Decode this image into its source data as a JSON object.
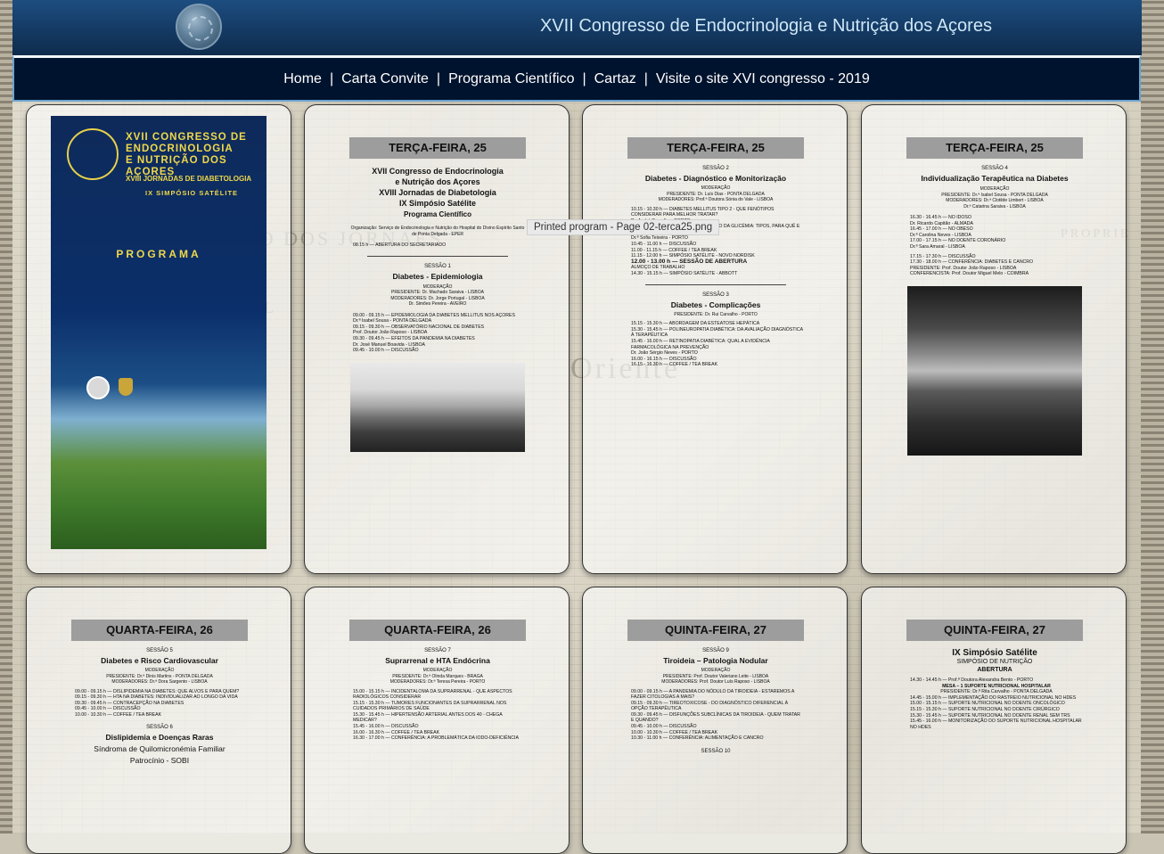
{
  "header": {
    "title": "XVII Congresso de Endocrinologia e Nutrição dos Açores"
  },
  "nav": {
    "items": [
      "Home",
      "Carta Convite",
      "Programa Científico",
      "Cartaz",
      "Visite o site XVI congresso - 2019"
    ],
    "separator": "|"
  },
  "tooltip": "Printed program - Page 02-terca25.png",
  "cover": {
    "title_lines": [
      "XVII CONGRESSO DE",
      "ENDOCRINOLOGIA",
      "E NUTRIÇÃO DOS AÇORES"
    ],
    "subtitle": "XVIII JORNADAS DE DIABETOLOGIA",
    "subtitle2": "IX SIMPÓSIO SATÉLITE",
    "program": "PROGRAMA"
  },
  "pages": {
    "p2": {
      "day": "TERÇA-FEIRA, 25",
      "intro": [
        "XVII Congresso de Endocrinologia",
        "e Nutrição dos Açores",
        "XVIII Jornadas de Diabetologia",
        "IX Simpósio Satélite"
      ],
      "intro_sub": "Programa Científico",
      "org": "Organização: Serviço de Endocrinologia e Nutrição do Hospital do Divino Espírito Santo de Ponta Delgada - EPER",
      "opening": "08.15 h — ABERTURA DO SECRETARIADO",
      "session": "SESSÃO 1",
      "session_title": "Diabetes - Epidemiologia",
      "moderation": "MODERAÇÃO",
      "president": "PRESIDENTE: Dr. Machado Saraiva - LISBOA",
      "moderators": "MODERADORES: Dr. Jorge Portugal - LISBOA",
      "moderators2": "Dr. Simões Pereira - AVEIRO",
      "lines": [
        "09.00 - 09.15 h — EPIDEMIOLOGIA DA DIABETES MELLITUS NOS AÇORES",
        "Dr.ª Isabel Sousa - PONTA DELGADA",
        "09.15 - 09.30 h — OBSERVATÓRIO NACIONAL DE DIABETES",
        "Prof. Doutor João Raposo - LISBOA",
        "09.30 - 09.45 h — EFEITOS DA PANDEMIA NA DIABETES",
        "Dr. José Manuel Boavida - LISBOA",
        "09.45 - 10.00 h — DISCUSSÃO"
      ]
    },
    "p3": {
      "day": "TERÇA-FEIRA, 25",
      "session": "SESSÃO 2",
      "session_title": "Diabetes - Diagnóstico e Monitorização",
      "moderation": "MODERAÇÃO",
      "president": "PRESIDENTE: Dr. Luís Dias - PONTA DELGADA",
      "moderators": "MODERADORES: Prof.ª Doutora Sónia do Vale - LISBOA",
      "lines": [
        "10.15 - 10.30 h — DIABETES MELLITUS TIPO 2 - QUE FENÓTIPOS CONSIDERAR PARA MELHOR TRATAR?",
        "Dr. André Carvalho - PORTO",
        "10.30 - 10.45 h — AUTO-MONITORIZAÇÃO DA GLICÉMIA: TIPOS, PARA QUÊ E PARA QUEM?",
        "Dr.ª Sofia Teixeira - PORTO",
        "10.45 - 11.00 h — DISCUSSÃO",
        "11.00 - 11.15 h — COFFEE / TEA BREAK",
        "11.15 - 12.00 h — SIMPÓSIO SATÉLITE - NOVO NORDISK",
        "12.00 - 13.00 h — SESSÃO DE ABERTURA",
        "ALMOÇO DE TRABALHO",
        "14.30 - 15.15 h — SIMPÓSIO SATÉLITE - ABBOTT"
      ],
      "session2": "SESSÃO 3",
      "session2_title": "Diabetes - Complicações",
      "president2": "PRESIDENTE: Dr. Rui Carvalho - PORTO",
      "lines2": [
        "15.15 - 15.30 h — ABORDAGEM DA ESTEATOSE HEPÁTICA",
        "15.30 - 15.45 h — POLINEUROPATIA DIABÉTICA: DA AVALIAÇÃO DIAGNÓSTICA À TERAPÊUTICA",
        "15.45 - 16.00 h — RETINOPATIA DIABÉTICA: QUAL A EVIDÊNCIA FARMACOLÓGICA NA PREVENÇÃO",
        "Dr. João Sérgio Neves - PORTO",
        "16.00 - 16.15 h — DISCUSSÃO",
        "16.15 - 16.30 h — COFFEE / TEA BREAK"
      ]
    },
    "p4": {
      "day": "TERÇA-FEIRA, 25",
      "session": "SESSÃO 4",
      "session_title": "Individualização Terapêutica na Diabetes",
      "moderation": "MODERAÇÃO",
      "president": "PRESIDENTE: Dr.ª Isabel Sousa - PONTA DELGADA",
      "moderators": "MODERADORES: Dr.ª Clotilde Limbert - LISBOA",
      "moderators2": "Dr.ª Catarina Saraiva - LISBOA",
      "lines": [
        "16.30 - 16.45 h — NO IDOSO",
        "Dr. Ricardo Capitão - ALMADA",
        "16.45 - 17.00 h — NO OBESO",
        "Dr.ª Carolina Neves - LISBOA",
        "17.00 - 17.15 h — NO DOENTE CORONÁRIO",
        "Dr.ª Sara Amaral - LISBOA",
        "17.15 - 17.30 h — DISCUSSÃO",
        "17.30 - 18.00 h — CONFERÊNCIA: DIABETES E CANCRO",
        "PRESIDENTE: Prof. Doutor João Raposo - LISBOA",
        "CONFERENCISTA: Prof. Doutor Miguel Melo - COIMBRA"
      ]
    },
    "p5": {
      "day": "QUARTA-FEIRA, 26",
      "session": "SESSÃO 5",
      "session_title": "Diabetes e Risco Cardiovascular",
      "moderation": "MODERAÇÃO",
      "president": "PRESIDENTE: Dr.ª Dinis Martins - PONTA DELGADA",
      "moderators": "MODERADORES: Dr.ª Dora Sargento - LISBOA",
      "lines": [
        "09.00 - 09.15 h — DISLIPIDEMIA NA DIABETES: QUE ALVOS E PARA QUEM?",
        "09.15 - 09.30 h — HTA NA DIABETES: INDIVIDUALIZAR AO LONGO DA VIDA",
        "09.30 - 09.45 h — CONTRACEPÇÃO NA DIABETES",
        "09.45 - 10.00 h — DISCUSSÃO",
        "10.00 - 10.30 h — COFFEE / TEA BREAK"
      ],
      "session2": "SESSÃO 6",
      "session2_title": "Dislipidemia e Doenças Raras",
      "session2_sub": "Síndroma de Quilomicronémia Familiar",
      "session2_sub2": "Patrocínio - SOBI"
    },
    "p6": {
      "day": "QUARTA-FEIRA, 26",
      "session": "SESSÃO 7",
      "session_title": "Suprarrenal e HTA Endócrina",
      "moderation": "MODERAÇÃO",
      "president": "PRESIDENTE: Dr.ª Olinda Marques - BRAGA",
      "moderators": "MODERADORES: Dr.ª Teresa Pereira - PORTO",
      "lines": [
        "15.00 - 15.15 h — INCIDENTALOMA DA SUPRARRENAL - QUE ASPECTOS RADIOLÓGICOS CONSIDERAR",
        "15.15 - 15.30 h — TUMORES FUNCIONANTES DA SUPRARRENAL NOS CUIDADOS PRIMÁRIOS DE SAÚDE",
        "15.30 - 15.45 h — HIPERTENSÃO ARTERIAL ANTES DOS 40 - CHEGA MEDICAR?",
        "15.45 - 16.00 h — DISCUSSÃO",
        "16.00 - 16.30 h — COFFEE / TEA BREAK",
        "16.30 - 17.00 h — CONFERÊNCIA: A PROBLEMÁTICA DA IODO-DEFICIÊNCIA"
      ]
    },
    "p7": {
      "day": "QUINTA-FEIRA, 27",
      "session": "SESSÃO 9",
      "session_title": "Tiroideia – Patologia Nodular",
      "moderation": "MODERAÇÃO",
      "president": "PRESIDENTE: Prof. Doutor Valeriano Leite - LISBOA",
      "moderators": "MODERADORES: Prof. Doutor Luís Raposo - LISBOA",
      "lines": [
        "09.00 - 09.15 h — A PANDEMIA DO NÓDULO DA TIROIDEIA - ESTAREMOS A FAZER CITOLOGIAS A MAIS?",
        "09.15 - 09.30 h — TIREOTOXICOSE - DO DIAGNÓSTICO DIFERENCIAL À OPÇÃO TERAPÊUTICA",
        "09.30 - 09.45 h — DISFUNÇÕES SUBCLÍNICAS DA TIROIDEIA - QUEM TRATAR E QUANDO?",
        "09.45 - 10.00 h — DISCUSSÃO",
        "10.00 - 10.30 h — COFFEE / TEA BREAK",
        "10.30 - 11.00 h — CONFERÊNCIA: ALIMENTAÇÃO E CANCRO"
      ],
      "session2": "SESSÃO 10"
    },
    "p8": {
      "day": "QUINTA-FEIRA, 27",
      "session_title": "IX Simpósio Satélite",
      "sub": "SIMPÓSIO DE NUTRIÇÃO",
      "opening": "ABERTURA",
      "lines": [
        "14.30 - 14.45 h — Prof.ª Doutora Alexandra Bento - PORTO",
        "MESA – 1 SUPORTE NUTRICIONAL HOSPITALAR",
        "PRESIDENTE: Dr.ª Rita Carvalho - PONTA DELGADA",
        "14.45 - 15.00 h — IMPLEMENTAÇÃO DO RASTREIO NUTRICIONAL NO HDES",
        "15.00 - 15.15 h — SUPORTE NUTRICIONAL NO DOENTE ONCOLÓGICO",
        "15.15 - 15.30 h — SUPORTE NUTRICIONAL NO DOENTE CIRÚRGICO",
        "15.30 - 15.45 h — SUPORTE NUTRICIONAL NO DOENTE RENAL SEM TRS",
        "15.45 - 16.00 h — MONITORIZAÇÃO DO SUPORTE NUTRICIONAL HOSPITALAR NO HDES"
      ]
    }
  }
}
